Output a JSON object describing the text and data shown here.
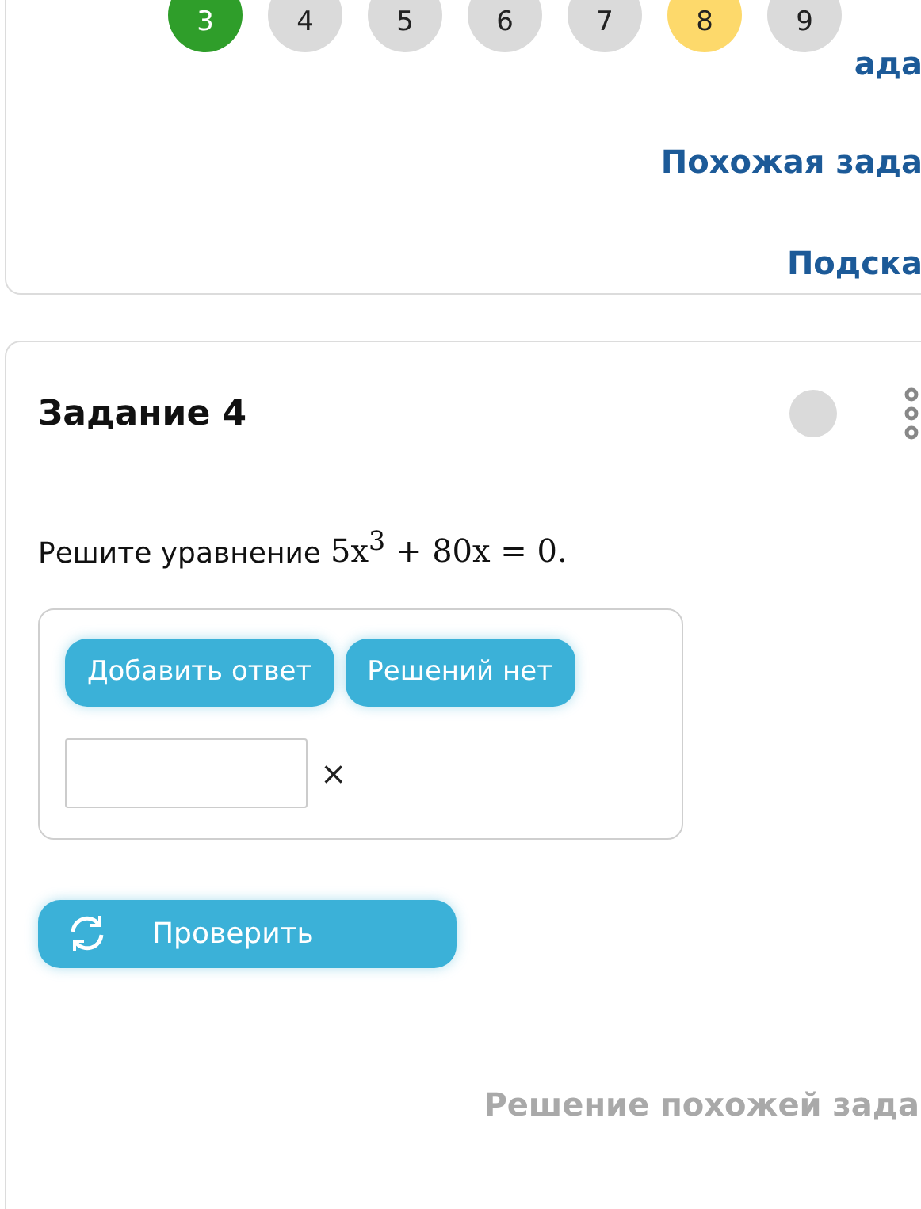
{
  "task_nav": [
    {
      "label": "3",
      "color": "#2f9e2a"
    },
    {
      "label": "4",
      "color": "#dadada"
    },
    {
      "label": "5",
      "color": "#dadada"
    },
    {
      "label": "6",
      "color": "#dadada"
    },
    {
      "label": "7",
      "color": "#dadada"
    },
    {
      "label": "8",
      "color": "#fdd96b"
    },
    {
      "label": "9",
      "color": "#dadada"
    }
  ],
  "top_links": [
    "ада",
    "Похожая зада",
    "Подска"
  ],
  "task": {
    "title": "Задание 4",
    "prompt": "Решите уравнение",
    "equation": "5x$^{3}$ + 80x = 0.",
    "answer_buttons": [
      "Добавить ответ",
      "Решений нет"
    ],
    "remove_mark": "×",
    "check_button": "Проверить"
  },
  "bottom_link": "Решение похожей зада"
}
